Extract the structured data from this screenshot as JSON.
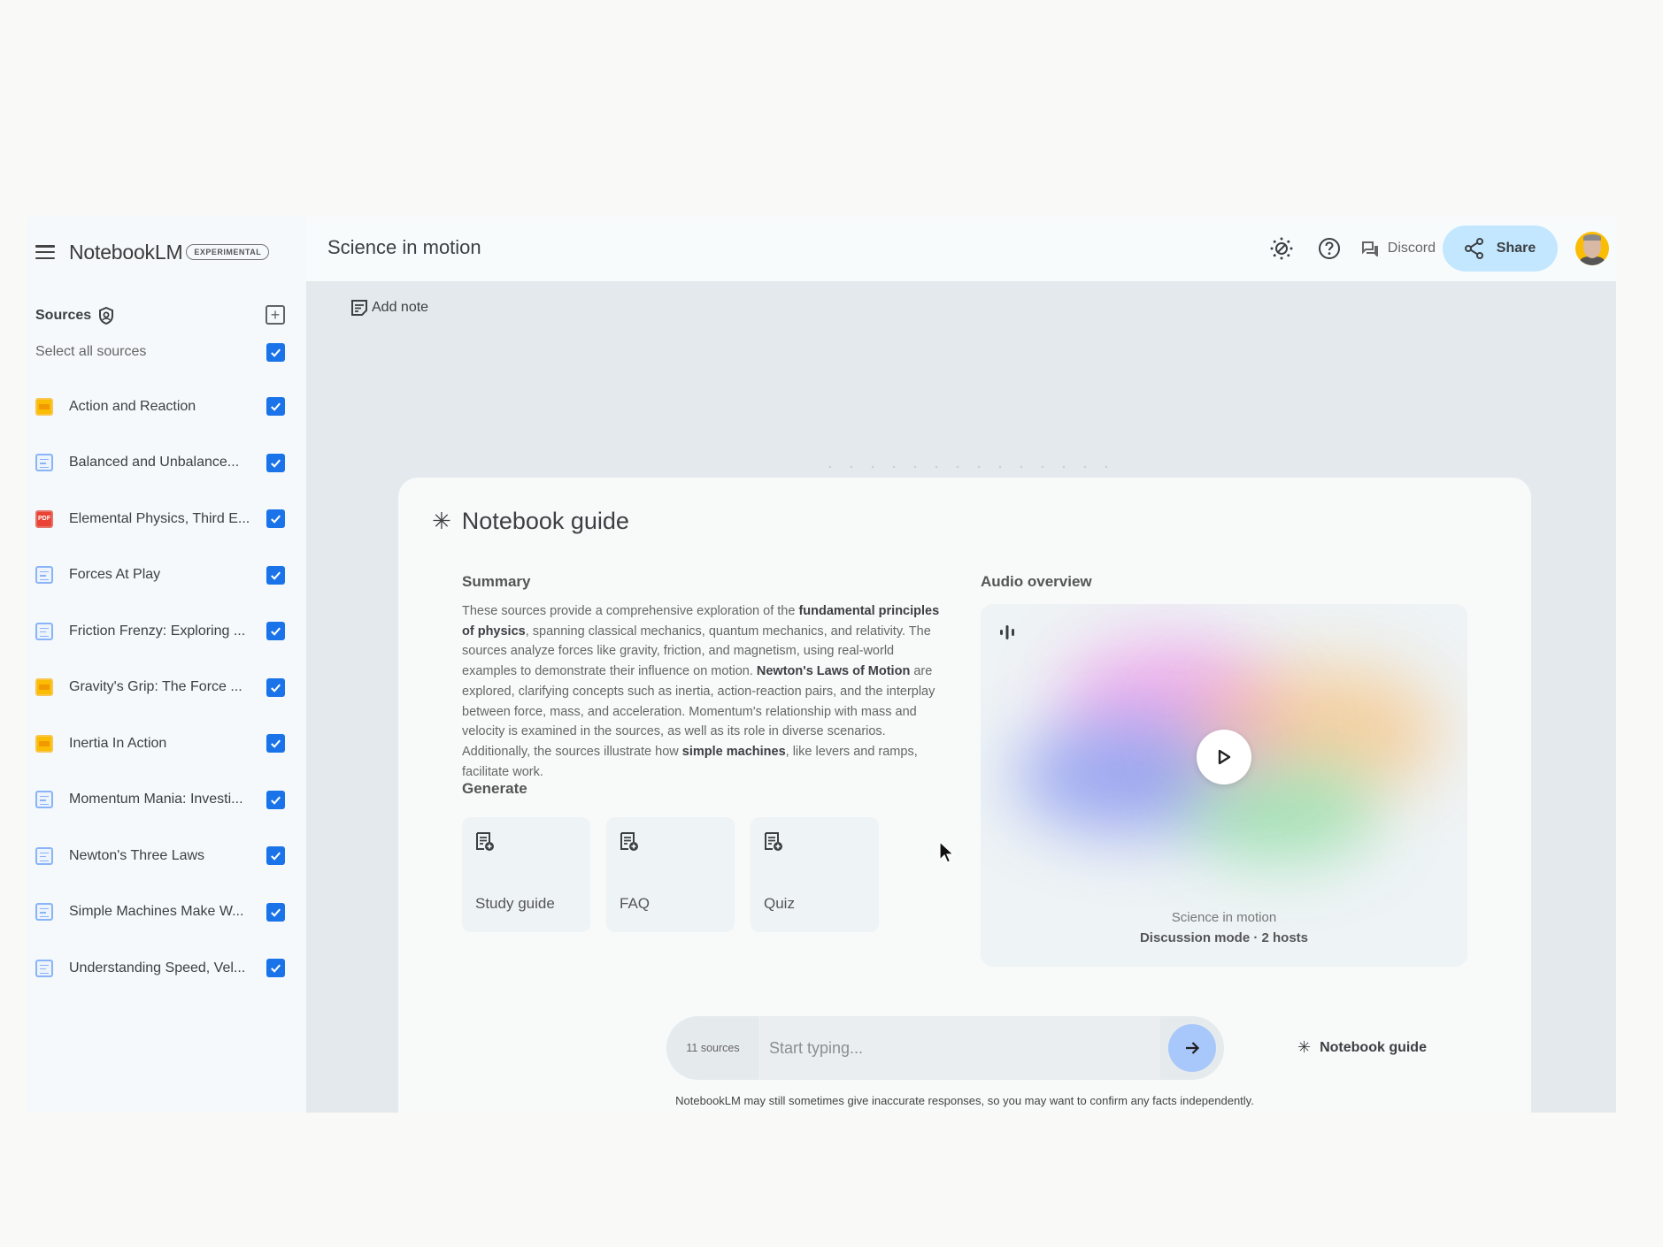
{
  "app": {
    "name": "NotebookLM",
    "badge": "EXPERIMENTAL",
    "notebook_title": "Science in motion"
  },
  "header": {
    "theme_icon": "theme-toggle-icon",
    "help_icon": "help-icon",
    "discord_label": "Discord",
    "share_label": "Share",
    "avatar_icon": "user-avatar"
  },
  "sidebar": {
    "sources_title": "Sources",
    "select_all_label": "Select all sources",
    "select_all_checked": true,
    "sources": [
      {
        "label": "Action and Reaction",
        "type": "slides",
        "checked": true
      },
      {
        "label": "Balanced and Unbalance...",
        "type": "doc",
        "checked": true
      },
      {
        "label": "Elemental Physics, Third E...",
        "type": "pdf",
        "checked": true
      },
      {
        "label": "Forces At Play",
        "type": "doc",
        "checked": true
      },
      {
        "label": "Friction Frenzy: Exploring ...",
        "type": "doc",
        "checked": true
      },
      {
        "label": "Gravity's Grip: The Force ...",
        "type": "slides",
        "checked": true
      },
      {
        "label": "Inertia In Action",
        "type": "slides",
        "checked": true
      },
      {
        "label": "Momentum Mania: Investi...",
        "type": "doc",
        "checked": true
      },
      {
        "label": "Newton's Three Laws",
        "type": "doc",
        "checked": true
      },
      {
        "label": "Simple Machines Make W...",
        "type": "doc",
        "checked": true
      },
      {
        "label": "Understanding Speed, Vel...",
        "type": "doc",
        "checked": true
      }
    ]
  },
  "main": {
    "add_note_label": "Add note",
    "guide": {
      "title": "Notebook guide",
      "summary_heading": "Summary",
      "summary": [
        {
          "text": "These sources provide a comprehensive exploration of the ",
          "bold": false
        },
        {
          "text": "fundamental principles of physics",
          "bold": true
        },
        {
          "text": ", spanning classical mechanics, quantum mechanics, and relativity. The sources analyze forces like gravity, friction, and magnetism, using real-world examples to demonstrate their influence on motion. ",
          "bold": false
        },
        {
          "text": "Newton's Laws of Motion",
          "bold": true
        },
        {
          "text": " are explored, clarifying concepts such as inertia, action-reaction pairs, and the interplay between force, mass, and acceleration. Momentum's relationship with mass and velocity is examined in the sources, as well as its role in diverse scenarios. Additionally, the sources illustrate how ",
          "bold": false
        },
        {
          "text": "simple machines",
          "bold": true
        },
        {
          "text": ", like levers and ramps, facilitate work.",
          "bold": false
        }
      ],
      "generate_heading": "Generate",
      "generate_items": [
        {
          "label": "Study guide"
        },
        {
          "label": "FAQ"
        },
        {
          "label": "Quiz"
        }
      ],
      "audio_heading": "Audio overview",
      "audio_title": "Science in motion",
      "audio_subtitle": "Discussion mode · 2 hosts"
    },
    "chat": {
      "sources_count": "11 sources",
      "placeholder": "Start typing...",
      "value": "",
      "guide_link_label": "Notebook guide"
    },
    "disclaimer": "NotebookLM may still sometimes give inaccurate responses, so you may want to confirm any facts independently."
  },
  "colors": {
    "accent_blue": "#1a73e8",
    "share_bg": "#c2e7ff",
    "send_bg": "#a8c7fa",
    "slides_yellow": "#fbbc04",
    "pdf_red": "#ea4335",
    "doc_blue": "#8ab4f8"
  }
}
